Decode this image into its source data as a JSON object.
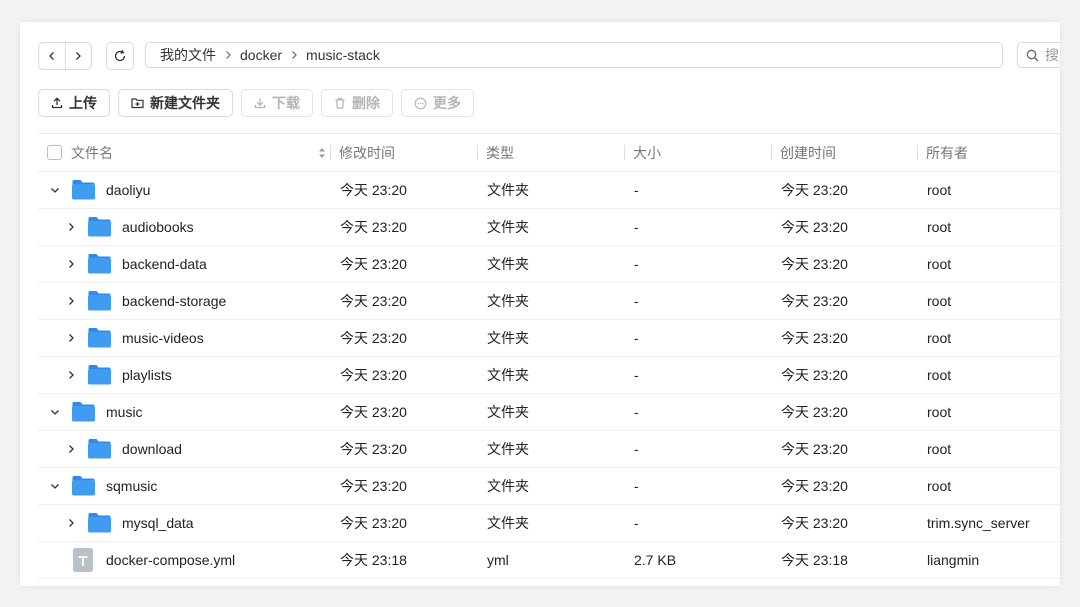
{
  "nav": {
    "breadcrumb": [
      "我的文件",
      "docker",
      "music-stack"
    ],
    "search_placeholder": "搜"
  },
  "toolbar": {
    "upload_label": "上传",
    "new_folder_label": "新建文件夹",
    "download_label": "下载",
    "delete_label": "删除",
    "more_label": "更多"
  },
  "columns": {
    "name": "文件名",
    "modified": "修改时间",
    "type": "类型",
    "size": "大小",
    "created": "创建时间",
    "owner": "所有者"
  },
  "colors": {
    "folder": "#3f9cf0",
    "folder_tab": "#2f8be6",
    "file_icon": "#b8c0c8"
  },
  "rows": [
    {
      "name": "daoliyu",
      "level": 0,
      "expander": "open",
      "icon": "folder-icon",
      "modified": "今天 23:20",
      "type": "文件夹",
      "size": "-",
      "created": "今天 23:20",
      "owner": "root"
    },
    {
      "name": "audiobooks",
      "level": 1,
      "expander": "closed",
      "icon": "folder-icon",
      "modified": "今天 23:20",
      "type": "文件夹",
      "size": "-",
      "created": "今天 23:20",
      "owner": "root"
    },
    {
      "name": "backend-data",
      "level": 1,
      "expander": "closed",
      "icon": "folder-icon",
      "modified": "今天 23:20",
      "type": "文件夹",
      "size": "-",
      "created": "今天 23:20",
      "owner": "root"
    },
    {
      "name": "backend-storage",
      "level": 1,
      "expander": "closed",
      "icon": "folder-icon",
      "modified": "今天 23:20",
      "type": "文件夹",
      "size": "-",
      "created": "今天 23:20",
      "owner": "root"
    },
    {
      "name": "music-videos",
      "level": 1,
      "expander": "closed",
      "icon": "folder-icon",
      "modified": "今天 23:20",
      "type": "文件夹",
      "size": "-",
      "created": "今天 23:20",
      "owner": "root"
    },
    {
      "name": "playlists",
      "level": 1,
      "expander": "closed",
      "icon": "folder-icon",
      "modified": "今天 23:20",
      "type": "文件夹",
      "size": "-",
      "created": "今天 23:20",
      "owner": "root"
    },
    {
      "name": "music",
      "level": 0,
      "expander": "open",
      "icon": "folder-icon",
      "modified": "今天 23:20",
      "type": "文件夹",
      "size": "-",
      "created": "今天 23:20",
      "owner": "root"
    },
    {
      "name": "download",
      "level": 1,
      "expander": "closed",
      "icon": "folder-icon",
      "modified": "今天 23:20",
      "type": "文件夹",
      "size": "-",
      "created": "今天 23:20",
      "owner": "root"
    },
    {
      "name": "sqmusic",
      "level": 0,
      "expander": "open",
      "icon": "folder-icon",
      "modified": "今天 23:20",
      "type": "文件夹",
      "size": "-",
      "created": "今天 23:20",
      "owner": "root"
    },
    {
      "name": "mysql_data",
      "level": 1,
      "expander": "closed",
      "icon": "folder-icon",
      "modified": "今天 23:20",
      "type": "文件夹",
      "size": "-",
      "created": "今天 23:20",
      "owner": "trim.sync_server"
    },
    {
      "name": "docker-compose.yml",
      "level": 0,
      "expander": "none",
      "icon": "text-file-icon",
      "modified": "今天 23:18",
      "type": "yml",
      "size": "2.7 KB",
      "created": "今天 23:18",
      "owner": "liangmin"
    }
  ]
}
